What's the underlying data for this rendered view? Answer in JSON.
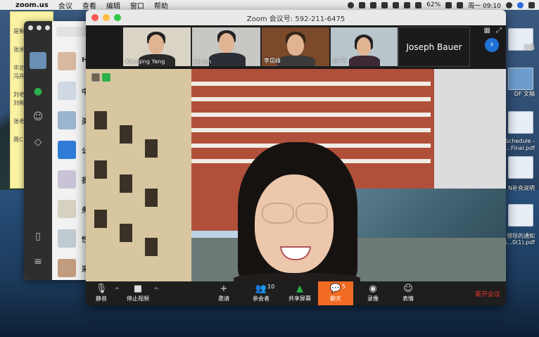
{
  "menubar": {
    "apple": "",
    "app": "zoom.us",
    "menus": [
      "会议",
      "查看",
      "编辑",
      "窗口",
      "帮助"
    ],
    "battery": "62%",
    "clock": "周一 09:10"
  },
  "note": {
    "lines": [
      "是新",
      "张米",
      "华北",
      "冯卉",
      "刘老",
      "刘新",
      "张老",
      "周C"
    ]
  },
  "chat": {
    "letters": [
      "中",
      "买",
      "公",
      "我",
      "务",
      "性",
      "采",
      "H"
    ]
  },
  "desktop_files": [
    "文稿",
    "DF 文稿",
    "Schedule -",
    "2...Final.pdf",
    "N补充说明",
    "给领导的通知",
    "S...0(1).pdf"
  ],
  "zoom": {
    "title": "Zoom 会议号: 592-211-6475",
    "gallery": [
      {
        "name": "Xiaoqing Yang"
      },
      {
        "name": "lai jun"
      },
      {
        "name": "李昆峰"
      },
      {
        "name": "陈 平"
      },
      {
        "name": "Joseph Bauer"
      }
    ],
    "toolbar": {
      "mute": "静音",
      "stop_video": "停止视频",
      "invite": "邀请",
      "participants": "参会者",
      "participants_count": "10",
      "share": "共享屏幕",
      "chat": "聊天",
      "chat_count": "5",
      "record": "录像",
      "reactions": "表情",
      "end": "离开会议"
    }
  },
  "colors": {
    "accent": "#f26b22",
    "end": "#e5362b",
    "share_green": "#2db14a",
    "next_blue": "#1e72d6"
  }
}
